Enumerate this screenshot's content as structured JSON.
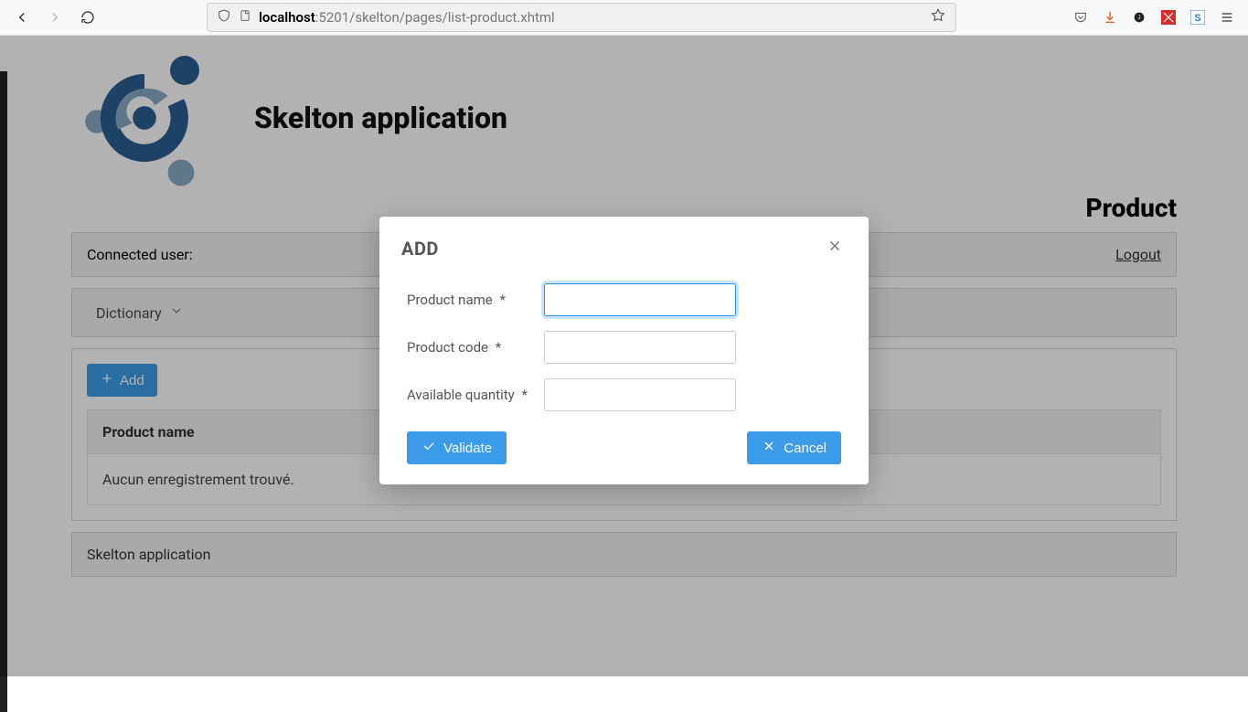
{
  "browser": {
    "url_host": "localhost",
    "url_rest": ":5201/skelton/pages/list-product.xhtml"
  },
  "header": {
    "app_title": "Skelton application",
    "page_title": "Product"
  },
  "user_bar": {
    "connected_label": "Connected user:",
    "logout": "Logout"
  },
  "menu": {
    "dictionary": "Dictionary"
  },
  "toolbar": {
    "add": "Add"
  },
  "table": {
    "col_product_name": "Product name",
    "empty_message": "Aucun enregistrement trouvé."
  },
  "footer": {
    "text": "Skelton application"
  },
  "dialog": {
    "title": "ADD",
    "fields": {
      "product_name": {
        "label": "Product name",
        "required": "*",
        "value": ""
      },
      "product_code": {
        "label": "Product code",
        "required": "*",
        "value": ""
      },
      "available_qty": {
        "label": "Available quantity",
        "required": "*",
        "value": ""
      }
    },
    "actions": {
      "validate": "Validate",
      "cancel": "Cancel"
    }
  }
}
